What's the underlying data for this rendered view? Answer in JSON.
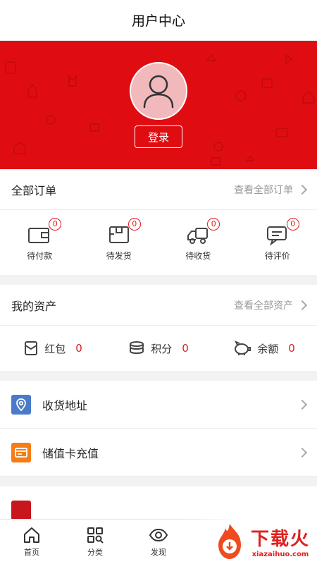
{
  "header": {
    "title": "用户中心"
  },
  "profile": {
    "login_label": "登录"
  },
  "orders": {
    "title": "全部订单",
    "view_all": "查看全部订单",
    "items": [
      {
        "label": "待付款",
        "count": "0",
        "icon": "wallet-icon"
      },
      {
        "label": "待发货",
        "count": "0",
        "icon": "package-icon"
      },
      {
        "label": "待收货",
        "count": "0",
        "icon": "truck-icon"
      },
      {
        "label": "待评价",
        "count": "0",
        "icon": "comment-icon"
      }
    ]
  },
  "assets": {
    "title": "我的资产",
    "view_all": "查看全部资产",
    "items": [
      {
        "label": "红包",
        "value": "0",
        "icon": "red-envelope-icon"
      },
      {
        "label": "积分",
        "value": "0",
        "icon": "coins-icon"
      },
      {
        "label": "余额",
        "value": "0",
        "icon": "piggy-bank-icon"
      }
    ]
  },
  "menu": {
    "items": [
      {
        "label": "收货地址",
        "icon": "location-icon",
        "color": "#4a7bc8"
      },
      {
        "label": "储值卡充值",
        "icon": "card-icon",
        "color": "#f57c17"
      }
    ]
  },
  "tabbar": {
    "items": [
      {
        "label": "首页",
        "icon": "home-icon"
      },
      {
        "label": "分类",
        "icon": "category-icon"
      },
      {
        "label": "发现",
        "icon": "eye-icon"
      }
    ]
  },
  "watermark": {
    "brand": "下载火",
    "domain": "xiazaihuo.com"
  },
  "colors": {
    "primary_red": "#df0d12",
    "badge_red": "#e01b1f",
    "value_red": "#d81e1e"
  }
}
